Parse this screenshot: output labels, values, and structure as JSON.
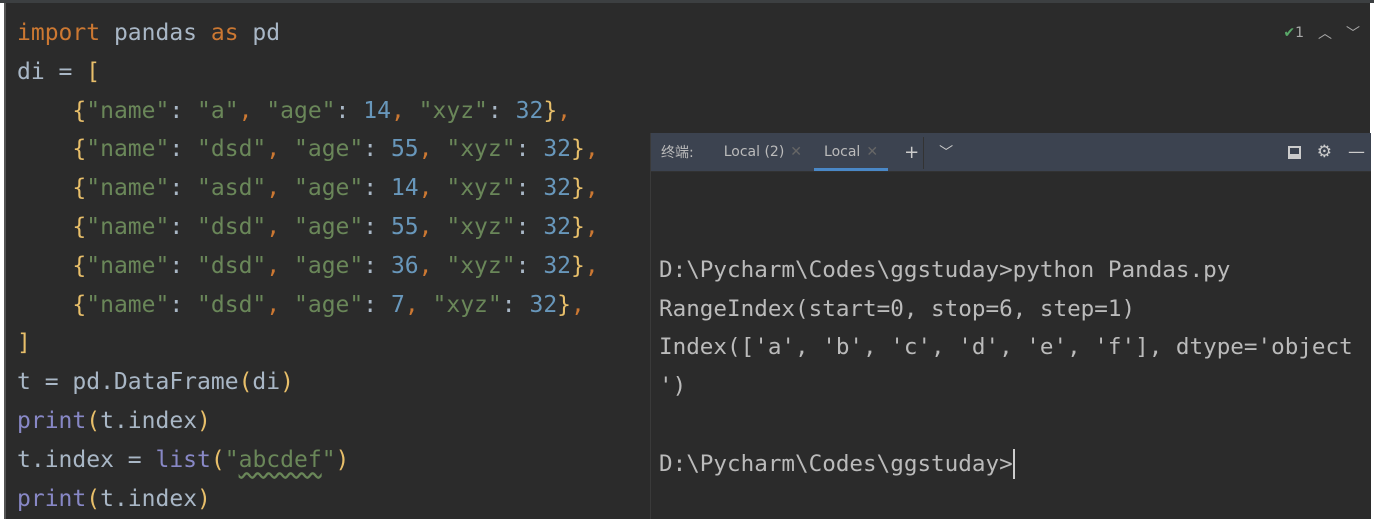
{
  "editor": {
    "lines": [
      [
        [
          "kw",
          "import"
        ],
        [
          "pl",
          " pandas "
        ],
        [
          "kw",
          "as"
        ],
        [
          "pl",
          " pd"
        ]
      ],
      [
        [
          "pl",
          "di = "
        ],
        [
          "br",
          "["
        ]
      ],
      [
        [
          "pl",
          "    "
        ],
        [
          "br",
          "{"
        ],
        [
          "str",
          "\"name\""
        ],
        [
          "pl",
          ": "
        ],
        [
          "str",
          "\"a\""
        ],
        [
          "kw",
          ", "
        ],
        [
          "str",
          "\"age\""
        ],
        [
          "pl",
          ": "
        ],
        [
          "num",
          "14"
        ],
        [
          "kw",
          ", "
        ],
        [
          "str",
          "\"xyz\""
        ],
        [
          "pl",
          ": "
        ],
        [
          "num",
          "32"
        ],
        [
          "br",
          "}"
        ],
        [
          "kw",
          ","
        ]
      ],
      [
        [
          "pl",
          "    "
        ],
        [
          "br",
          "{"
        ],
        [
          "str",
          "\"name\""
        ],
        [
          "pl",
          ": "
        ],
        [
          "str",
          "\"dsd\""
        ],
        [
          "kw",
          ", "
        ],
        [
          "str",
          "\"age\""
        ],
        [
          "pl",
          ": "
        ],
        [
          "num",
          "55"
        ],
        [
          "kw",
          ", "
        ],
        [
          "str",
          "\"xyz\""
        ],
        [
          "pl",
          ": "
        ],
        [
          "num",
          "32"
        ],
        [
          "br",
          "}"
        ],
        [
          "kw",
          ","
        ]
      ],
      [
        [
          "pl",
          "    "
        ],
        [
          "br",
          "{"
        ],
        [
          "str",
          "\"name\""
        ],
        [
          "pl",
          ": "
        ],
        [
          "str",
          "\"asd\""
        ],
        [
          "kw",
          ", "
        ],
        [
          "str",
          "\"age\""
        ],
        [
          "pl",
          ": "
        ],
        [
          "num",
          "14"
        ],
        [
          "kw",
          ", "
        ],
        [
          "str",
          "\"xyz\""
        ],
        [
          "pl",
          ": "
        ],
        [
          "num",
          "32"
        ],
        [
          "br",
          "}"
        ],
        [
          "kw",
          ","
        ]
      ],
      [
        [
          "pl",
          "    "
        ],
        [
          "br",
          "{"
        ],
        [
          "str",
          "\"name\""
        ],
        [
          "pl",
          ": "
        ],
        [
          "str",
          "\"dsd\""
        ],
        [
          "kw",
          ", "
        ],
        [
          "str",
          "\"age\""
        ],
        [
          "pl",
          ": "
        ],
        [
          "num",
          "55"
        ],
        [
          "kw",
          ", "
        ],
        [
          "str",
          "\"xyz\""
        ],
        [
          "pl",
          ": "
        ],
        [
          "num",
          "32"
        ],
        [
          "br",
          "}"
        ],
        [
          "kw",
          ","
        ]
      ],
      [
        [
          "pl",
          "    "
        ],
        [
          "br",
          "{"
        ],
        [
          "str",
          "\"name\""
        ],
        [
          "pl",
          ": "
        ],
        [
          "str",
          "\"dsd\""
        ],
        [
          "kw",
          ", "
        ],
        [
          "str",
          "\"age\""
        ],
        [
          "pl",
          ": "
        ],
        [
          "num",
          "36"
        ],
        [
          "kw",
          ", "
        ],
        [
          "str",
          "\"xyz\""
        ],
        [
          "pl",
          ": "
        ],
        [
          "num",
          "32"
        ],
        [
          "br",
          "}"
        ],
        [
          "kw",
          ","
        ]
      ],
      [
        [
          "pl",
          "    "
        ],
        [
          "br",
          "{"
        ],
        [
          "str",
          "\"name\""
        ],
        [
          "pl",
          ": "
        ],
        [
          "str",
          "\"dsd\""
        ],
        [
          "kw",
          ", "
        ],
        [
          "str",
          "\"age\""
        ],
        [
          "pl",
          ": "
        ],
        [
          "num",
          "7"
        ],
        [
          "kw",
          ", "
        ],
        [
          "str",
          "\"xyz\""
        ],
        [
          "pl",
          ": "
        ],
        [
          "num",
          "32"
        ],
        [
          "br",
          "}"
        ],
        [
          "kw",
          ","
        ]
      ],
      [
        [
          "br",
          "]"
        ]
      ],
      [
        [
          "pl",
          "t = pd.DataFrame"
        ],
        [
          "br",
          "("
        ],
        [
          "pl",
          "di"
        ],
        [
          "br",
          ")"
        ]
      ],
      [
        [
          "bi",
          "print"
        ],
        [
          "br",
          "("
        ],
        [
          "pl",
          "t.index"
        ],
        [
          "br",
          ")"
        ]
      ],
      [
        [
          "pl",
          "t.index = "
        ],
        [
          "bi",
          "list"
        ],
        [
          "br",
          "("
        ],
        [
          "str",
          "\""
        ],
        [
          "str squig",
          "abcdef"
        ],
        [
          "str",
          "\""
        ],
        [
          "br",
          ")"
        ]
      ],
      [
        [
          "bi",
          "print"
        ],
        [
          "br",
          "("
        ],
        [
          "pl",
          "t.index"
        ],
        [
          "br",
          ")"
        ]
      ]
    ],
    "inspection": {
      "count": "1",
      "icon": "check-icon"
    }
  },
  "terminal": {
    "label": "终端:",
    "tabs": [
      {
        "label": "Local (2)",
        "active": false
      },
      {
        "label": "Local",
        "active": true
      }
    ],
    "output": [
      "",
      "D:\\Pycharm\\Codes\\ggstuday>python Pandas.py",
      "RangeIndex(start=0, stop=6, step=1)",
      "Index(['a', 'b', 'c', 'd', 'e', 'f'], dtype='object",
      "')",
      "",
      "D:\\Pycharm\\Codes\\ggstuday>"
    ]
  },
  "colors": {
    "keyword": "#cc7832",
    "string": "#6a8759",
    "number": "#6897bb",
    "builtin": "#8888c6",
    "accent": "#4a88c7"
  }
}
